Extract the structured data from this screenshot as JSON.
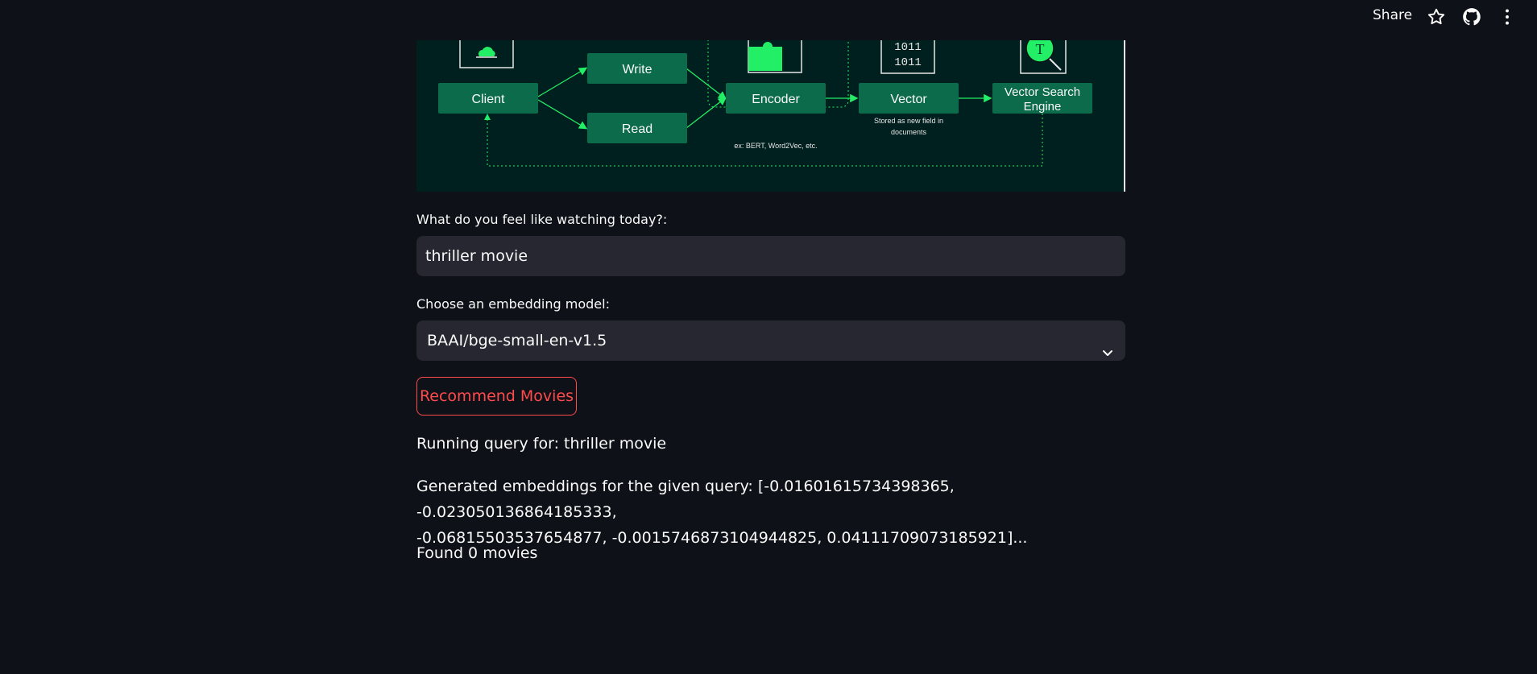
{
  "toolbar": {
    "share_label": "Share",
    "icons": [
      "star-icon",
      "github-icon",
      "more-vertical-icon"
    ]
  },
  "diagram": {
    "nodes": {
      "client": "Client",
      "write": "Write",
      "read": "Read",
      "encoder": "Encoder",
      "vector": "Vector",
      "vse_line1": "Vector Search",
      "vse_line2": "Engine"
    },
    "notes": {
      "encoder_note": "ex: BERT, Word2Vec, etc.",
      "vector_note_line1": "Stored as new field in",
      "vector_note_line2": "documents"
    },
    "binary_rows": [
      "1011",
      "1011"
    ],
    "colors": {
      "background": "#00201f",
      "node": "#0b6b4a",
      "accent": "#22ee66"
    }
  },
  "form": {
    "query_label": "What do you feel like watching today?:",
    "query_value": "thriller movie",
    "model_label": "Choose an embedding model:",
    "model_value": "BAAI/bge-small-en-v1.5",
    "recommend_button": "Recommend Movies"
  },
  "output": {
    "running_query": "Running query for: thriller movie",
    "embeddings_line1": "Generated embeddings for the given query: [-0.01601615734398365, -0.023050136864185333,",
    "embeddings_line2": "-0.06815503537654877, -0.0015746873104944825, 0.04111709073185921]...",
    "found": "Found 0 movies"
  },
  "theme": {
    "background": "#0e1117",
    "input_bg": "#262730",
    "primary": "#ff4b4b",
    "text": "#fafafa"
  }
}
